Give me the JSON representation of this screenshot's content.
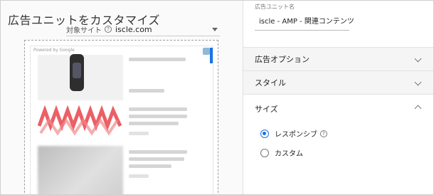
{
  "page": {
    "title": "広告ユニットをカスタマイズ",
    "site_label": "対象サイト",
    "site_help": "?",
    "site_value": "iscle.com"
  },
  "preview": {
    "powered_by": "Powered by Google"
  },
  "panel": {
    "name_label": "広告ユニット名",
    "name_value": "iscle - AMP - 関連コンテンツ",
    "sections": [
      {
        "label": "広告オプション"
      },
      {
        "label": "スタイル"
      },
      {
        "label": "サイズ"
      }
    ],
    "size_options": [
      {
        "label": "レスポンシブ",
        "selected": true,
        "help": "?"
      },
      {
        "label": "カスタム",
        "selected": false
      }
    ]
  },
  "colors": {
    "accent": "#1a73e8"
  }
}
